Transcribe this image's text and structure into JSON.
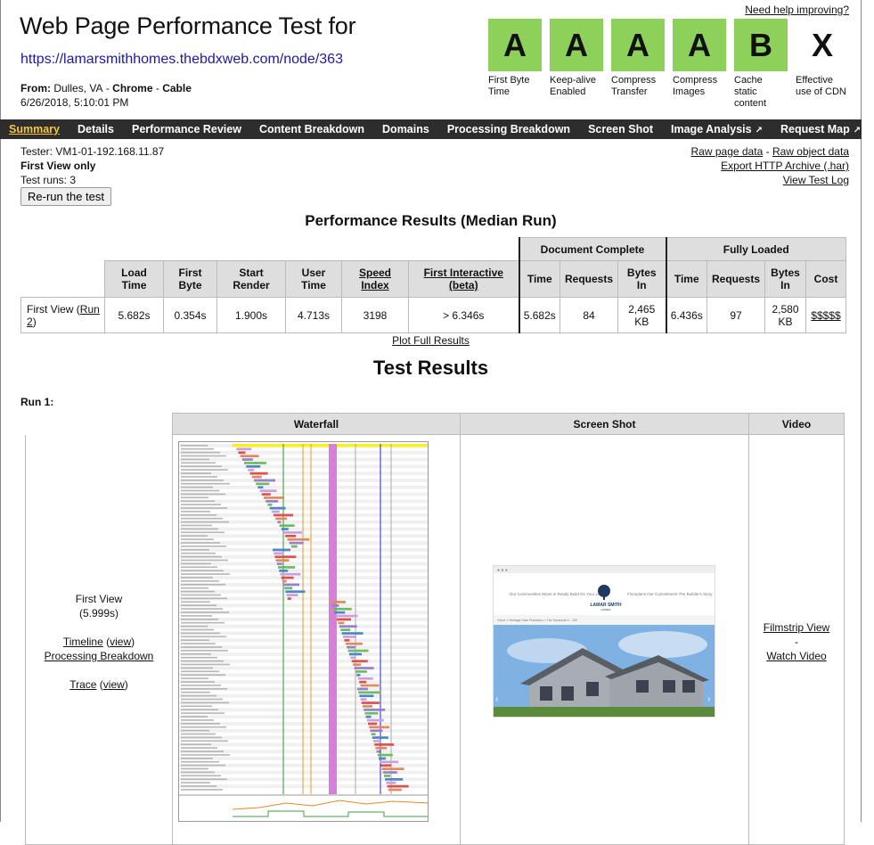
{
  "header": {
    "title": "Web Page Performance Test for",
    "url": "https://lamarsmithhomes.thebdxweb.com/node/363",
    "from_label": "From:",
    "from_location": "Dulles, VA",
    "from_browser": "Chrome",
    "from_connection": "Cable",
    "date": "6/26/2018, 5:10:01 PM",
    "help_link": "Need help improving?"
  },
  "grades": [
    {
      "grade": "A",
      "label": "First Byte Time",
      "color": "#8ed15a"
    },
    {
      "grade": "A",
      "label": "Keep-alive Enabled",
      "color": "#8ed15a"
    },
    {
      "grade": "A",
      "label": "Compress Transfer",
      "color": "#8ed15a"
    },
    {
      "grade": "A",
      "label": "Compress Images",
      "color": "#8ed15a"
    },
    {
      "grade": "B",
      "label": "Cache static content",
      "color": "#8ed15a"
    },
    {
      "grade": "X",
      "label": "Effective use of CDN",
      "color": "#ffffff"
    }
  ],
  "nav": {
    "items": [
      "Summary",
      "Details",
      "Performance Review",
      "Content Breakdown",
      "Domains",
      "Processing Breakdown",
      "Screen Shot",
      "Image Analysis",
      "Request Map"
    ],
    "active": "Summary",
    "external_icon": "external-link-icon"
  },
  "info": {
    "tester": "Tester: VM1-01-192.168.11.87",
    "view": "First View only",
    "runs": "Test runs: 3",
    "rerun_button": "Re-run the test",
    "raw_page": "Raw page data",
    "dash": "-",
    "raw_object": "Raw object data",
    "export": "Export HTTP Archive (.har)",
    "log": "View Test Log"
  },
  "perf": {
    "title": "Performance Results (Median Run)",
    "group_doc": "Document Complete",
    "group_full": "Fully Loaded",
    "headers": {
      "load_time": "Load Time",
      "first_byte": "First Byte",
      "start_render": "Start Render",
      "user_time": "User Time",
      "speed_index": "Speed Index",
      "first_interactive": "First Interactive (beta)",
      "time": "Time",
      "requests": "Requests",
      "bytes_in": "Bytes In",
      "cost": "Cost"
    },
    "row_label": "First View (",
    "row_link": "Run 2",
    "row_close": ")",
    "values": {
      "load_time": "5.682s",
      "first_byte": "0.354s",
      "start_render": "1.900s",
      "user_time": "4.713s",
      "speed_index": "3198",
      "first_interactive": "> 6.346s",
      "doc_time": "5.682s",
      "doc_requests": "84",
      "doc_bytes": "2,465 KB",
      "full_time": "6.436s",
      "full_requests": "97",
      "full_bytes": "2,580 KB",
      "cost": "$$$$$"
    },
    "plot_link": "Plot Full Results"
  },
  "test_results": {
    "title": "Test Results",
    "run_label": "Run 1:",
    "col_waterfall": "Waterfall",
    "col_screenshot": "Screen Shot",
    "col_video": "Video",
    "first_view": "First View",
    "first_view_time": "(5.999s)",
    "timeline": "Timeline",
    "view": "view",
    "processing": "Processing Breakdown",
    "trace": "Trace",
    "filmstrip": "Filmstrip View",
    "dash": "-",
    "watch_video": "Watch Video"
  },
  "screenshot": {
    "nav_left": "Our Communities   Move-in Ready   Build On Your Lot",
    "logo_text": "LAMAR SMITH",
    "logo_sub": "HOMES",
    "nav_right": "Floorplans   Our Commitment   The Builder's Story",
    "breadcrumb": "Home  >  Heritage Gate Plantation  >  The Savannah II - 220"
  }
}
